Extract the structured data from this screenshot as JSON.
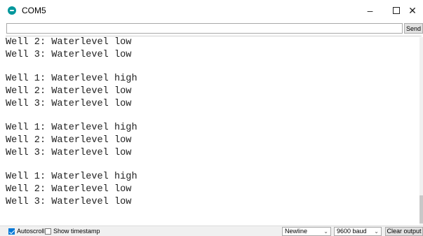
{
  "window": {
    "title": "COM5",
    "minimize": "–",
    "close": "✕"
  },
  "send_bar": {
    "input_value": "",
    "send_label": "Send"
  },
  "output_lines": [
    "Well 2: Waterlevel low",
    "Well 3: Waterlevel low",
    "",
    "Well 1: Waterlevel high",
    "Well 2: Waterlevel low",
    "Well 3: Waterlevel low",
    "",
    "Well 1: Waterlevel high",
    "Well 2: Waterlevel low",
    "Well 3: Waterlevel low",
    "",
    "Well 1: Waterlevel high",
    "Well 2: Waterlevel low",
    "Well 3: Waterlevel low"
  ],
  "status": {
    "autoscroll_label": "Autoscroll",
    "autoscroll_checked": true,
    "timestamp_label": "Show timestamp",
    "timestamp_checked": false,
    "line_ending": "Newline",
    "baud_rate": "9600 baud",
    "clear_label": "Clear output"
  },
  "colors": {
    "accent": "#0078d7",
    "app_icon": "#00979c"
  }
}
